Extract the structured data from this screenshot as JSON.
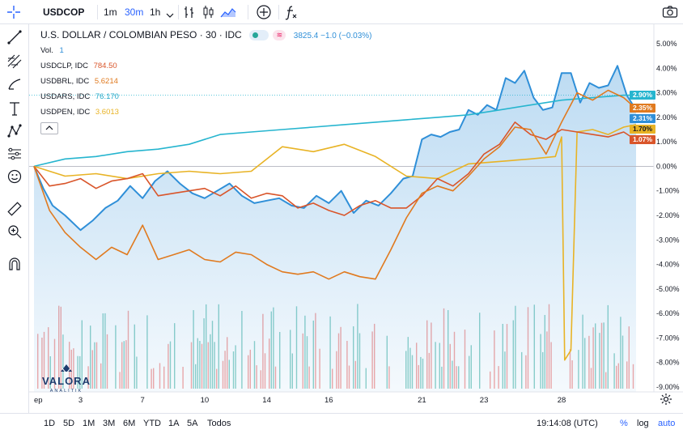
{
  "toolbar": {
    "symbol": "USDCOP",
    "intervals": [
      "1m",
      "30m",
      "1h"
    ],
    "active_interval": "30m"
  },
  "legend": {
    "title": "U.S. DOLLAR / COLOMBIAN PESO · 30 · IDC",
    "price_text": "3825.4  −1.0 (−0.03%)",
    "vol_label": "Vol.",
    "vol_value": "1",
    "compare": [
      {
        "label": "USDCLP, IDC",
        "value": "784.50",
        "color": "#d9552a"
      },
      {
        "label": "USDBRL, IDC",
        "value": "5.6214",
        "color": "#e07a1f"
      },
      {
        "label": "USDARS, IDC",
        "value": "76.170",
        "color": "#26a9c9"
      },
      {
        "label": "USDPEN, IDC",
        "value": "3.6013",
        "color": "#e8b325"
      }
    ]
  },
  "bottom": {
    "ranges": [
      "1D",
      "5D",
      "1M",
      "3M",
      "6M",
      "YTD",
      "1A",
      "5A",
      "Todos"
    ],
    "clock": "19:14:08 (UTC)",
    "percent": "%",
    "log": "log",
    "auto": "auto"
  },
  "logo": {
    "name": "VALORA",
    "sub": "ANALITIK"
  },
  "chart_data": {
    "type": "line",
    "y_unit": "percent change",
    "ylim": [
      -9,
      5
    ],
    "y_ticks": [
      "5.00%",
      "4.00%",
      "3.00%",
      "2.00%",
      "1.00%",
      "0.00%",
      "-1.00%",
      "-2.00%",
      "-3.00%",
      "-4.00%",
      "-5.00%",
      "-6.00%",
      "-7.00%",
      "-8.00%",
      "-9.00%"
    ],
    "x_ticks": [
      "ep",
      "3",
      "7",
      "10",
      "14",
      "16",
      "21",
      "23",
      "28"
    ],
    "x_tick_pos": [
      0,
      1.5,
      3.5,
      5.5,
      7.5,
      9.5,
      12.5,
      14.5,
      17
    ],
    "xlim": [
      0,
      19.4
    ],
    "series": [
      {
        "name": "USDCOP",
        "color": "#2f8fd8",
        "area": true,
        "last_label": "2.31%",
        "x": [
          0,
          0.3,
          0.6,
          1.0,
          1.5,
          1.9,
          2.3,
          2.7,
          3.1,
          3.5,
          3.9,
          4.3,
          4.7,
          5.1,
          5.5,
          5.9,
          6.3,
          6.7,
          7.1,
          7.5,
          7.9,
          8.3,
          8.7,
          9.1,
          9.5,
          9.9,
          10.3,
          10.7,
          11.1,
          11.5,
          11.9,
          12.2,
          12.5,
          12.8,
          13.1,
          13.4,
          13.7,
          14.0,
          14.3,
          14.6,
          14.9,
          15.2,
          15.5,
          15.8,
          16.1,
          16.4,
          16.7,
          17.0,
          17.3,
          17.6,
          17.9,
          18.2,
          18.5,
          18.8,
          19.1,
          19.4
        ],
        "y": [
          0.0,
          -0.9,
          -1.6,
          -2.0,
          -2.6,
          -2.2,
          -1.7,
          -1.4,
          -0.8,
          -1.3,
          -0.6,
          -0.2,
          -0.7,
          -1.1,
          -1.3,
          -1.0,
          -0.7,
          -1.2,
          -1.5,
          -1.4,
          -1.3,
          -1.6,
          -1.7,
          -1.2,
          -1.5,
          -1.0,
          -1.9,
          -1.4,
          -1.6,
          -1.1,
          -0.5,
          -0.4,
          1.1,
          1.3,
          1.2,
          1.4,
          1.5,
          2.3,
          2.1,
          2.5,
          2.3,
          3.6,
          3.4,
          3.9,
          2.8,
          2.3,
          2.4,
          3.8,
          3.8,
          2.6,
          3.4,
          3.2,
          3.3,
          4.1,
          2.9,
          2.3
        ]
      },
      {
        "name": "USDARS",
        "color": "#26b5cf",
        "area": false,
        "last_label": "2.90%",
        "x": [
          0,
          1.0,
          2.0,
          3.0,
          4.0,
          5.0,
          6.0,
          7.0,
          8.0,
          9.0,
          10.0,
          11.0,
          12.0,
          13.0,
          14.0,
          15.0,
          16.0,
          17.0,
          18.0,
          19.0,
          19.4
        ],
        "y": [
          0.0,
          0.3,
          0.4,
          0.6,
          0.7,
          0.9,
          1.3,
          1.4,
          1.5,
          1.6,
          1.7,
          1.8,
          1.9,
          2.0,
          2.1,
          2.3,
          2.5,
          2.7,
          2.8,
          2.9,
          2.9
        ]
      },
      {
        "name": "USDPEN",
        "color": "#e8b325",
        "area": false,
        "last_label": "1.70%",
        "x": [
          0,
          1.0,
          2.0,
          3.0,
          4.0,
          5.0,
          6.0,
          7.0,
          8.0,
          9.0,
          10.0,
          11.0,
          12.0,
          13.0,
          14.0,
          15.0,
          16.0,
          16.8,
          17.0,
          17.1,
          17.3,
          17.5,
          18.0,
          18.5,
          19.0,
          19.4
        ],
        "y": [
          0.0,
          -0.4,
          -0.3,
          -0.5,
          -0.3,
          -0.2,
          -0.3,
          -0.2,
          0.8,
          0.6,
          0.9,
          0.4,
          -0.4,
          -0.5,
          0.1,
          0.2,
          0.3,
          0.4,
          1.2,
          -7.9,
          -7.5,
          1.4,
          1.5,
          1.3,
          1.6,
          1.7
        ]
      },
      {
        "name": "USDCLP",
        "color": "#d9552a",
        "area": false,
        "last_label": "1.07%",
        "x": [
          0,
          0.5,
          1.0,
          1.5,
          2.0,
          2.5,
          3.0,
          3.5,
          4.0,
          4.5,
          5.0,
          5.5,
          6.0,
          6.5,
          7.0,
          7.5,
          8.0,
          8.5,
          9.0,
          9.5,
          10.0,
          10.5,
          11.0,
          11.5,
          12.0,
          12.5,
          13.0,
          13.5,
          14.0,
          14.5,
          15.0,
          15.5,
          16.0,
          16.5,
          17.0,
          17.5,
          18.0,
          18.5,
          19.0,
          19.4
        ],
        "y": [
          0.0,
          -0.8,
          -0.7,
          -0.5,
          -0.9,
          -0.6,
          -0.5,
          -0.3,
          -1.2,
          -1.1,
          -1.0,
          -0.9,
          -1.2,
          -0.8,
          -1.3,
          -1.1,
          -1.2,
          -1.7,
          -1.5,
          -1.8,
          -2.0,
          -1.6,
          -1.4,
          -1.7,
          -1.7,
          -1.2,
          -0.5,
          -0.8,
          -0.3,
          0.5,
          0.9,
          1.8,
          1.3,
          1.1,
          1.5,
          1.4,
          1.3,
          1.2,
          1.4,
          1.07
        ]
      },
      {
        "name": "USDBRL",
        "color": "#e07a1f",
        "area": false,
        "last_label": "2.35%",
        "x": [
          0,
          0.5,
          1.0,
          1.5,
          2.0,
          2.5,
          3.0,
          3.5,
          4.0,
          4.5,
          5.0,
          5.5,
          6.0,
          6.5,
          7.0,
          7.5,
          8.0,
          8.5,
          9.0,
          9.5,
          10.0,
          10.5,
          11.0,
          11.5,
          12.0,
          12.5,
          13.0,
          13.5,
          14.0,
          14.5,
          15.0,
          15.5,
          16.0,
          16.5,
          17.0,
          17.5,
          18.0,
          18.5,
          19.0,
          19.4
        ],
        "y": [
          0.0,
          -1.8,
          -2.7,
          -3.3,
          -3.8,
          -3.3,
          -3.6,
          -2.4,
          -3.8,
          -3.6,
          -3.4,
          -3.8,
          -3.9,
          -3.5,
          -3.6,
          -4.0,
          -4.3,
          -4.4,
          -4.3,
          -4.6,
          -4.3,
          -4.5,
          -4.6,
          -3.4,
          -2.1,
          -1.1,
          -0.8,
          -1.0,
          -0.4,
          0.3,
          0.8,
          1.6,
          1.5,
          0.5,
          1.8,
          3.0,
          2.7,
          3.1,
          2.8,
          2.35
        ]
      }
    ],
    "volume_bars_shown": true
  }
}
